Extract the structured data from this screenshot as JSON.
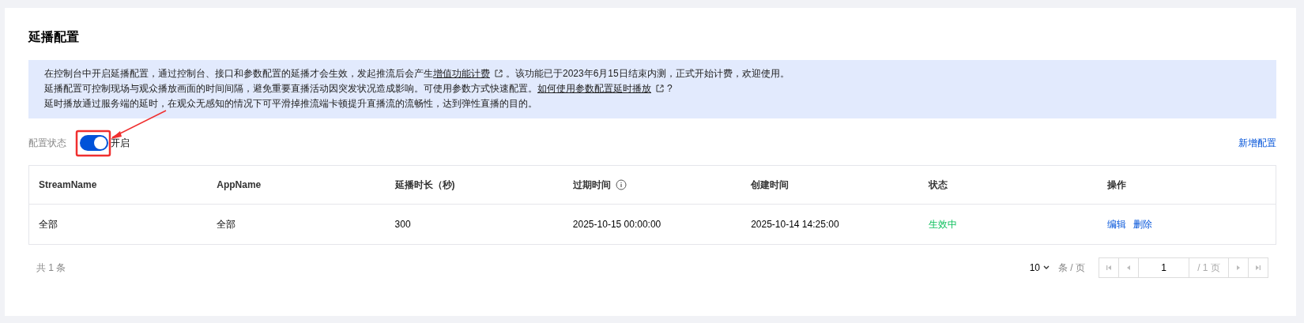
{
  "title": "延播配置",
  "notice": [
    {
      "parts": [
        {
          "kind": "text",
          "text": "在控制台中开启延播配置，通过控制台、接口和参数配置的延播才会生效，发起推流后会产生"
        },
        {
          "kind": "link",
          "text": "增值功能计费"
        },
        {
          "kind": "text",
          "text": "。该功能已于2023年6月15日结束内测，正式开始计费，欢迎使用。"
        }
      ]
    },
    {
      "parts": [
        {
          "kind": "text",
          "text": "延播配置可控制现场与观众播放画面的时间间隔，避免重要直播活动因突发状况造成影响。可使用参数方式快速配置。"
        },
        {
          "kind": "link",
          "text": "如何使用参数配置延时播放"
        },
        {
          "kind": "text",
          "text": "?"
        }
      ]
    },
    {
      "parts": [
        {
          "kind": "text",
          "text": "延时播放通过服务端的延时，在观众无感知的情况下可平滑掉推流端卡顿提升直播流的流畅性，达到弹性直播的目的。"
        }
      ]
    }
  ],
  "status": {
    "label": "配置状态",
    "on": true,
    "text": "开启"
  },
  "add_button": "新增配置",
  "table": {
    "columns": [
      {
        "label": "StreamName",
        "info": false
      },
      {
        "label": "AppName",
        "info": false
      },
      {
        "label": "延播时长（秒)",
        "info": false
      },
      {
        "label": "过期时间",
        "info": true
      },
      {
        "label": "创建时间",
        "info": false
      },
      {
        "label": "状态",
        "info": false
      },
      {
        "label": "操作",
        "info": false
      }
    ],
    "rows": [
      {
        "stream": "全部",
        "app": "全部",
        "delay": "300",
        "expires": "2025-10-15 00:00:00",
        "created": "2025-10-14 14:25:00",
        "status": "生效中",
        "actions": [
          "编辑",
          "删除"
        ]
      }
    ]
  },
  "footer": {
    "total": "共 1 条",
    "page_size": "10",
    "per_page": "条 / 页",
    "page": "1",
    "pages": "/ 1 页"
  }
}
